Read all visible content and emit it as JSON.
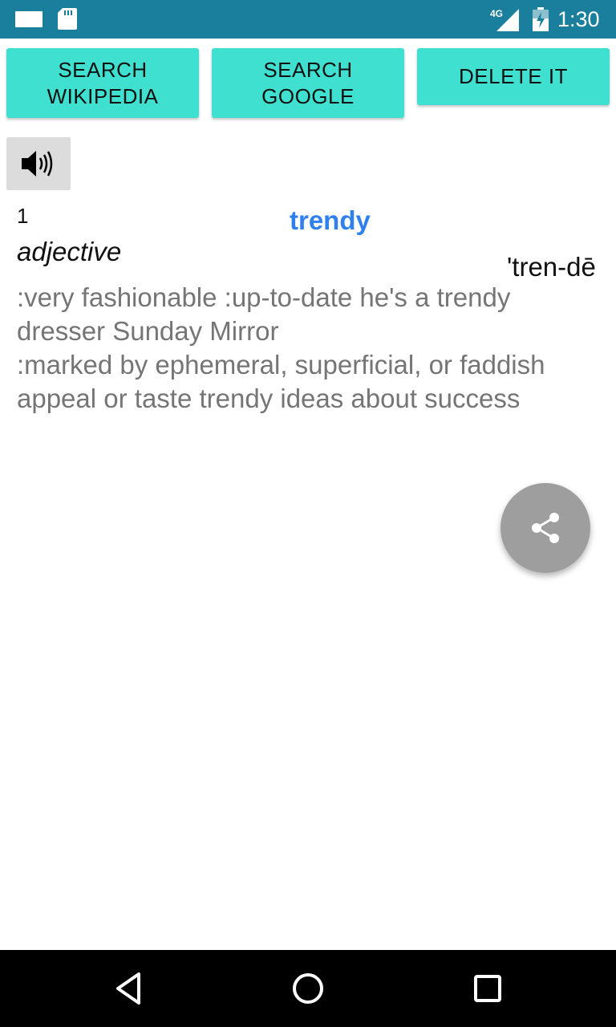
{
  "status_bar": {
    "time": "1:30",
    "network": "4G",
    "icons": [
      "mail-icon",
      "sd-card-icon",
      "signal-4g-icon",
      "battery-charging-icon"
    ]
  },
  "toolbar": {
    "search_wikipedia_label": "SEARCH\nWIKIPEDIA",
    "search_google_label": "SEARCH\nGOOGLE",
    "delete_label": "DELETE IT",
    "button_color": "#40e0d0"
  },
  "speaker": {
    "icon": "speaker-icon"
  },
  "entry": {
    "sense_number": "1",
    "headword": "trendy",
    "part_of_speech": "adjective",
    "pronunciation": "'tren-dē",
    "definitions": [
      ":very fashionable :up-to-date he's a trendy dresser Sunday Mirror",
      ":marked by ephemeral, superficial, or faddish appeal or taste trendy ideas about success"
    ],
    "headword_color": "#2f80ed"
  },
  "fab": {
    "icon": "share-icon"
  },
  "nav_bar": {
    "icons": [
      "back-icon",
      "home-icon",
      "recents-icon"
    ]
  }
}
